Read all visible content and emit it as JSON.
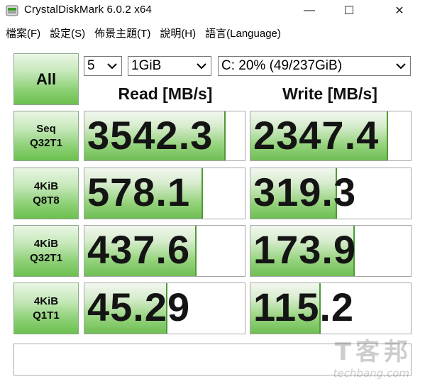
{
  "window": {
    "title": "CrystalDiskMark 6.0.2 x64",
    "icon": "crystaldiskmark-app-icon",
    "controls": {
      "minimize": "—",
      "maximize": "☐",
      "close": "✕"
    }
  },
  "menu": [
    {
      "label": "檔案(F)"
    },
    {
      "label": "設定(S)"
    },
    {
      "label": "佈景主題(T)"
    },
    {
      "label": "說明(H)"
    },
    {
      "label": "語言(Language)"
    }
  ],
  "toolbar": {
    "all_label": "All",
    "runs": "5",
    "size": "1GiB",
    "drive": "C: 20% (49/237GiB)"
  },
  "headers": {
    "read": "Read [MB/s]",
    "write": "Write [MB/s]"
  },
  "tests": [
    {
      "line1": "Seq",
      "line2": "Q32T1",
      "read": "3542.3",
      "write": "2347.4",
      "read_fill": 0.87,
      "write_fill": 0.85
    },
    {
      "line1": "4KiB",
      "line2": "Q8T8",
      "read": "578.1",
      "write": "319.3",
      "read_fill": 0.73,
      "write_fill": 0.53
    },
    {
      "line1": "4KiB",
      "line2": "Q32T1",
      "read": "437.6",
      "write": "173.9",
      "read_fill": 0.69,
      "write_fill": 0.64
    },
    {
      "line1": "4KiB",
      "line2": "Q1T1",
      "read": "45.29",
      "write": "115.2",
      "read_fill": 0.51,
      "write_fill": 0.43
    }
  ],
  "comment": "",
  "watermark": {
    "main": "T客邦",
    "sub": "techbang.com"
  },
  "colors": {
    "accent_green": "#6cc04f",
    "fill_border": "#4c9c35"
  }
}
